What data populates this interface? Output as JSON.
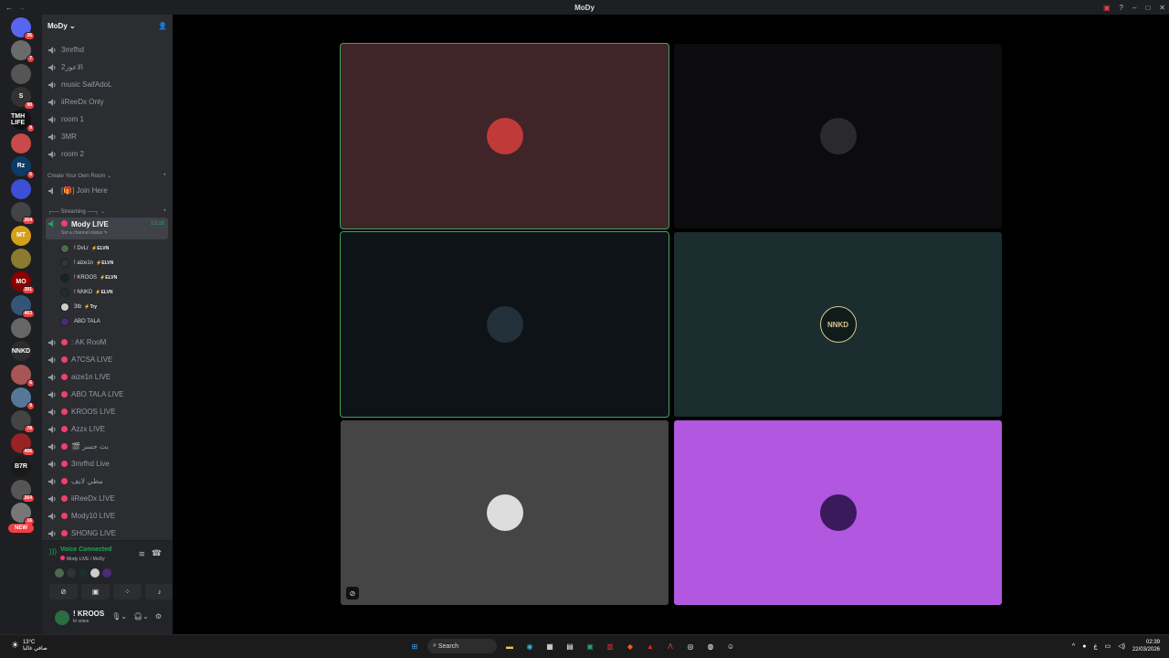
{
  "window": {
    "title": "MoDy",
    "back_icon": "arrow-left-icon",
    "forward_icon": "arrow-right-icon"
  },
  "guilds": [
    {
      "badge": "36",
      "color": "#5865f2",
      "label": "",
      "icon": "discord-home-icon"
    },
    {
      "badge": "7",
      "color": "#6b6b6b",
      "label": ""
    },
    {
      "badge": "",
      "color": "#555555",
      "label": "",
      "icon": "x-logo-icon"
    },
    {
      "badge": "98",
      "color": "#333333",
      "label": "S"
    },
    {
      "badge": "9",
      "color": "#111111",
      "label": "TMH LIFE"
    },
    {
      "badge": "",
      "color": "#c94a4a",
      "label": ""
    },
    {
      "badge": "6",
      "color": "#0d3b66",
      "label": "Rz"
    },
    {
      "badge": "",
      "color": "#3d4fd6",
      "label": "",
      "icon": "folder-icon"
    },
    {
      "badge": "264",
      "color": "#444444",
      "label": ""
    },
    {
      "badge": "",
      "color": "#d4a017",
      "label": "MT"
    },
    {
      "badge": "",
      "color": "#8c7a32",
      "label": ""
    },
    {
      "badge": "391",
      "color": "#8b0000",
      "label": "MO"
    },
    {
      "badge": "463",
      "color": "#335577",
      "label": ""
    },
    {
      "badge": "",
      "color": "#666666",
      "label": ""
    },
    {
      "badge": "",
      "color": "#2c2c2c",
      "label": "NNKD"
    },
    {
      "badge": "6",
      "color": "#aa5555",
      "label": ""
    },
    {
      "badge": "9",
      "color": "#557799",
      "label": ""
    },
    {
      "badge": "78",
      "color": "#444444",
      "label": ""
    },
    {
      "badge": "406",
      "color": "#992222",
      "label": ""
    },
    {
      "badge": "",
      "color": "#1a1a1a",
      "label": "B7R"
    },
    {
      "badge": "264",
      "color": "#555555",
      "label": ""
    },
    {
      "badge": "16",
      "color": "#777777",
      "label": ""
    }
  ],
  "new_badge": "NEW",
  "server": {
    "name": "MoDy",
    "chevron_icon": "chevron-down-icon",
    "invite_icon": "add-member-icon"
  },
  "channels_top": [
    {
      "name": "3mrfhd"
    },
    {
      "name": "الاعوز2"
    },
    {
      "name": "music SaifAdoL"
    },
    {
      "name": "iiReeDx Only"
    },
    {
      "name": "room 1"
    },
    {
      "name": "3MR"
    },
    {
      "name": "room 2"
    }
  ],
  "categories": {
    "create_room": "Create Your Own Room",
    "streaming": "┌── Streaming ──┐"
  },
  "join_channel": {
    "name": "[🎁] Join Here"
  },
  "active_channel": {
    "name": "Mody LIVE",
    "time": "13:16",
    "status_hint": "Set a channel status"
  },
  "voice_members": [
    {
      "name": "! DvLr",
      "tag": "ELVN"
    },
    {
      "name": "! aize1n",
      "tag": "ELVN"
    },
    {
      "name": "! KROOS",
      "tag": "ELVN"
    },
    {
      "name": "! NNKD",
      "tag": "ELVN"
    },
    {
      "name": "3tb",
      "tag": "Try"
    },
    {
      "name": "ABO TALA",
      "tag": ""
    }
  ],
  "channels_live": [
    {
      "name": ": AK RooM"
    },
    {
      "name": "A7CSA LIVE"
    },
    {
      "name": "aize1n LIVE"
    },
    {
      "name": "ABO TALA LIVE"
    },
    {
      "name": "KROOS LIVE"
    },
    {
      "name": "Azzx LIVE"
    },
    {
      "name": "🎬 بث جسر"
    },
    {
      "name": "3mrfhd Live"
    },
    {
      "name": "مطي لايف"
    },
    {
      "name": "iiReeDx LIVE"
    },
    {
      "name": "Mody10 LIVE"
    },
    {
      "name": "SHONG LIVE"
    }
  ],
  "voice_panel": {
    "status": "Voice Connected",
    "sub": "Mody LIVE / MoDy",
    "buttons": [
      "camera-off-icon",
      "screen-share-icon",
      "activities-icon",
      "soundboard-icon"
    ]
  },
  "user_panel": {
    "name": "! KROOS",
    "status": "In voice"
  },
  "tiles": [
    {
      "bg": "#3f2428",
      "speaking": true,
      "avatar": "#c03a3a"
    },
    {
      "bg": "#0c0c0e",
      "speaking": false,
      "avatar": "#2a2a2e"
    },
    {
      "bg": "#0d1317",
      "speaking": true,
      "avatar": "#223039"
    },
    {
      "bg": "#1b2d2f",
      "speaking": false,
      "avatar": "#101b1c",
      "avatar_text": "NNKD"
    },
    {
      "bg": "#454545",
      "speaking": false,
      "avatar": "#dddddd"
    },
    {
      "bg": "#b157e0",
      "speaking": false,
      "avatar": "#3a1a5a"
    }
  ],
  "taskbar": {
    "temp": "13°C",
    "weather_text": "صافي غالبا",
    "search": "Search",
    "clock_time": "02:39",
    "clock_date": "22/03/2026",
    "lang": "ع"
  }
}
